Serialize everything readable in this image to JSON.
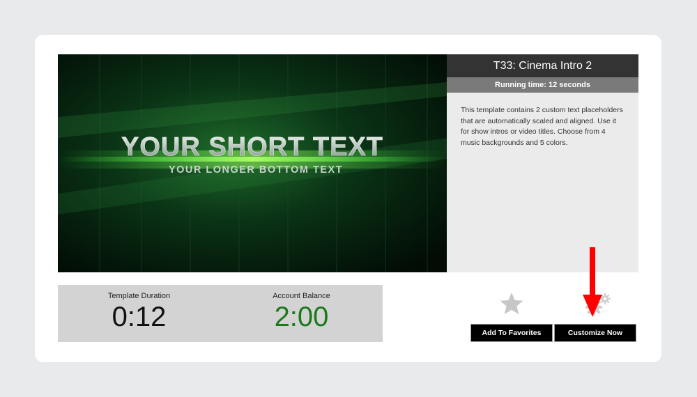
{
  "template": {
    "title": "T33: Cinema Intro 2",
    "running_time": "Running time: 12 seconds",
    "description": "This template contains 2 custom text placeholders that are automatically scaled and aligned. Use it for show intros or video titles. Choose from 4 music backgrounds and 5 colors."
  },
  "preview": {
    "main_text": "YOUR SHORT TEXT",
    "sub_text": "YOUR LONGER BOTTOM TEXT"
  },
  "stats": {
    "duration_label": "Template Duration",
    "duration_value": "0:12",
    "balance_label": "Account Balance",
    "balance_value": "2:00"
  },
  "actions": {
    "favorites_label": "Add To Favorites",
    "customize_label": "Customize Now"
  },
  "icons": {
    "favorite": "star-icon",
    "customize": "gear-icon",
    "pointer": "arrow-down-icon"
  },
  "colors": {
    "title_bar": "#333333",
    "runtime_bar": "#7a7a7a",
    "balance_value": "#1a7a1a",
    "arrow": "#ff0000",
    "button": "#000000"
  }
}
